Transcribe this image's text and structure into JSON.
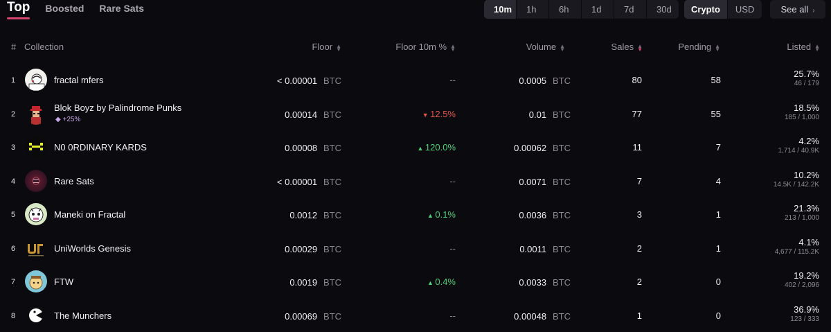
{
  "tabs": [
    "Top",
    "Boosted",
    "Rare Sats"
  ],
  "timeframes": [
    "10m",
    "1h",
    "6h",
    "1d",
    "7d",
    "30d"
  ],
  "currency": [
    "Crypto",
    "USD"
  ],
  "see_all": "See all",
  "columns": {
    "rank": "#",
    "collection": "Collection",
    "floor": "Floor",
    "floor_change": "Floor 10m %",
    "volume": "Volume",
    "sales": "Sales",
    "pending": "Pending",
    "listed": "Listed"
  },
  "rows": [
    {
      "rank": "1",
      "name": "fractal mfers",
      "badge": "",
      "floor": "< 0.00001",
      "floor_unit": "BTC",
      "change": "--",
      "dir": "flat",
      "volume": "0.0005",
      "volume_unit": "BTC",
      "sales": "80",
      "pending": "58",
      "listed_pct": "25.7%",
      "listed_count": "46 / 179",
      "avatar": "mfers-avatar"
    },
    {
      "rank": "2",
      "name": "Blok Boyz by Palindrome Punks",
      "badge": "+25%",
      "floor": "0.00014",
      "floor_unit": "BTC",
      "change": "12.5%",
      "dir": "down",
      "volume": "0.01",
      "volume_unit": "BTC",
      "sales": "77",
      "pending": "55",
      "listed_pct": "18.5%",
      "listed_count": "185 / 1,000",
      "avatar": "blokboyz-avatar"
    },
    {
      "rank": "3",
      "name": "N0 0RDINARY KARDS",
      "badge": "",
      "floor": "0.00008",
      "floor_unit": "BTC",
      "change": "120.0%",
      "dir": "up",
      "volume": "0.00062",
      "volume_unit": "BTC",
      "sales": "11",
      "pending": "7",
      "listed_pct": "4.2%",
      "listed_count": "1,714 / 40.9K",
      "avatar": "kards-avatar"
    },
    {
      "rank": "4",
      "name": "Rare Sats",
      "badge": "",
      "floor": "< 0.00001",
      "floor_unit": "BTC",
      "change": "--",
      "dir": "flat",
      "volume": "0.0071",
      "volume_unit": "BTC",
      "sales": "7",
      "pending": "4",
      "listed_pct": "10.2%",
      "listed_count": "14.5K / 142.2K",
      "avatar": "raresats-avatar"
    },
    {
      "rank": "5",
      "name": "Maneki on Fractal",
      "badge": "",
      "floor": "0.0012",
      "floor_unit": "BTC",
      "change": "0.1%",
      "dir": "up",
      "volume": "0.0036",
      "volume_unit": "BTC",
      "sales": "3",
      "pending": "1",
      "listed_pct": "21.3%",
      "listed_count": "213 / 1,000",
      "avatar": "maneki-avatar"
    },
    {
      "rank": "6",
      "name": "UniWorlds Genesis",
      "badge": "",
      "floor": "0.00029",
      "floor_unit": "BTC",
      "change": "--",
      "dir": "flat",
      "volume": "0.0011",
      "volume_unit": "BTC",
      "sales": "2",
      "pending": "1",
      "listed_pct": "4.1%",
      "listed_count": "4,677 / 115.2K",
      "avatar": "uniworlds-avatar"
    },
    {
      "rank": "7",
      "name": "FTW",
      "badge": "",
      "floor": "0.0019",
      "floor_unit": "BTC",
      "change": "0.4%",
      "dir": "up",
      "volume": "0.0033",
      "volume_unit": "BTC",
      "sales": "2",
      "pending": "0",
      "listed_pct": "19.2%",
      "listed_count": "402 / 2,096",
      "avatar": "ftw-avatar"
    },
    {
      "rank": "8",
      "name": "The Munchers",
      "badge": "",
      "floor": "0.00069",
      "floor_unit": "BTC",
      "change": "--",
      "dir": "flat",
      "volume": "0.00048",
      "volume_unit": "BTC",
      "sales": "1",
      "pending": "0",
      "listed_pct": "36.9%",
      "listed_count": "123 / 333",
      "avatar": "munchers-avatar"
    }
  ],
  "colors": {
    "background": "#0b0a0e",
    "accent": "#d9466f",
    "up": "#4fd07c",
    "down": "#e5564d",
    "badge": "#c8a8e9"
  }
}
